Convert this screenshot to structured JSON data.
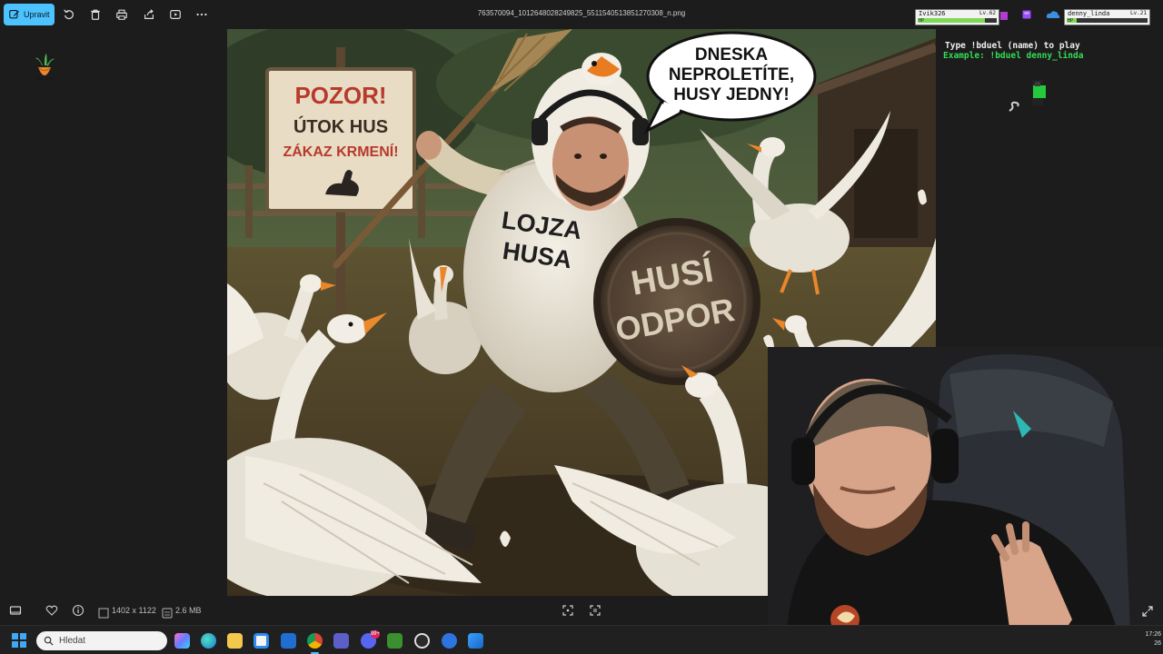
{
  "toolbar": {
    "edit_label": "Upravit",
    "icons": [
      "edit-icon",
      "rotate-icon",
      "delete-icon",
      "print-icon",
      "share-icon",
      "slideshow-icon",
      "more-icon"
    ]
  },
  "file": {
    "name": "763570094_1012648028249825_5511540513851270308_n.png",
    "dimensions": "1402 x 1122",
    "size": "2.6 MB"
  },
  "image_content": {
    "sign_line1": "POZOR!",
    "sign_line2": "ÚTOK HUS",
    "sign_line3": "ZÁKAZ KRMENÍ!",
    "speech_line1": "DNESKA",
    "speech_line2": "NEPROLETÍTE,",
    "speech_line3": "HUSY JEDNY!",
    "shirt_line1": "LOJZA",
    "shirt_line2": "HUSA",
    "shield_line1": "HUSÍ",
    "shield_line2": "ODPOR"
  },
  "overlay": {
    "player1": {
      "name": "Ivik326",
      "level": "Lv.62",
      "hp_label": "HP",
      "hp_fraction": 0.85
    },
    "player2": {
      "name": "denny_linda",
      "level": "Lv.21",
      "hp_label": "HP",
      "hp_fraction": 0.12
    },
    "duel_instruction": "Type !bduel (name) to play",
    "duel_example": "Example: !bduel denny_linda"
  },
  "taskbar": {
    "search_placeholder": "Hledat",
    "apps": [
      "copilot-icon",
      "edge-icon",
      "file-explorer-icon",
      "store-icon",
      "outlook-icon",
      "chrome-icon",
      "teams-icon",
      "discord-icon",
      "minecraft-icon",
      "obs-icon",
      "app-icon",
      "photos-icon"
    ],
    "discord_badge": "99+",
    "clock_time": "17:26",
    "clock_date": "26"
  },
  "colors": {
    "accent": "#4cc2ff",
    "background": "#1c1c1c",
    "duel_green": "#33dd55"
  }
}
